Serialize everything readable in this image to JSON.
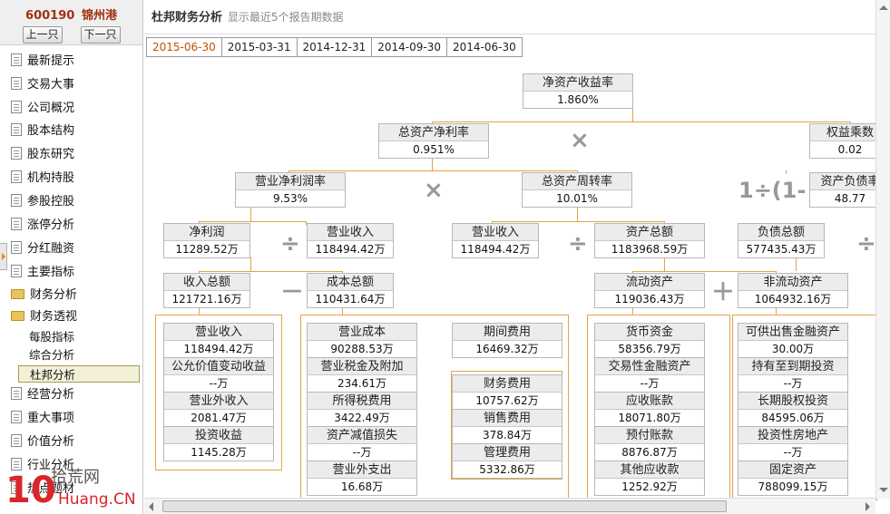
{
  "stock": {
    "code": "600190",
    "name": "锦州港",
    "prev_btn": "上一只",
    "next_btn": "下一只"
  },
  "nav": [
    {
      "label": "最新提示",
      "icon": "doc-icon"
    },
    {
      "label": "交易大事",
      "icon": "doc-icon"
    },
    {
      "label": "公司概况",
      "icon": "doc-icon"
    },
    {
      "label": "股本结构",
      "icon": "doc-icon"
    },
    {
      "label": "股东研究",
      "icon": "doc-icon"
    },
    {
      "label": "机构持股",
      "icon": "doc-icon"
    },
    {
      "label": "参股控股",
      "icon": "doc-icon"
    },
    {
      "label": "涨停分析",
      "icon": "doc-icon"
    },
    {
      "label": "分红融资",
      "icon": "doc-icon"
    },
    {
      "label": "主要指标",
      "icon": "doc-icon"
    },
    {
      "label": "财务分析",
      "icon": "folder-icon"
    },
    {
      "label": "财务透视",
      "icon": "folder-open-icon"
    }
  ],
  "sub_nav": [
    {
      "label": "每股指标"
    },
    {
      "label": "综合分析"
    },
    {
      "label": "杜邦分析"
    }
  ],
  "nav2": [
    {
      "label": "经营分析"
    },
    {
      "label": "重大事项"
    },
    {
      "label": "价值分析"
    },
    {
      "label": "行业分析"
    },
    {
      "label": "热点题材"
    }
  ],
  "logo": {
    "main": "拾荒网",
    "url": "Huang.CN",
    "num": "10"
  },
  "page": {
    "title": "杜邦财务分析",
    "subtitle": "显示最近5个报告期数据"
  },
  "tabs": [
    "2015-06-30",
    "2015-03-31",
    "2014-12-31",
    "2014-09-30",
    "2014-06-30"
  ],
  "active_tab": 0,
  "ops": {
    "times": "×",
    "divide": "÷",
    "minus": "－",
    "plus": "＋",
    "one_minus": "1÷(1-"
  },
  "nodes": {
    "roe": {
      "label": "净资产收益率",
      "value": "1.860%"
    },
    "roa": {
      "label": "总资产净利率",
      "value": "0.951%"
    },
    "em": {
      "label": "权益乘数",
      "value": "0.02"
    },
    "npm": {
      "label": "营业净利润率",
      "value": "9.53%"
    },
    "tat": {
      "label": "总资产周转率",
      "value": "10.01%"
    },
    "dr": {
      "label": "资产负债率",
      "value": "48.77"
    },
    "np": {
      "label": "净利润",
      "value": "11289.52万"
    },
    "rev1": {
      "label": "营业收入",
      "value": "118494.42万"
    },
    "rev2": {
      "label": "营业收入",
      "value": "118494.42万"
    },
    "ta": {
      "label": "资产总额",
      "value": "1183968.59万"
    },
    "tl": {
      "label": "负债总额",
      "value": "577435.43万"
    },
    "ti": {
      "label": "收入总额",
      "value": "121721.16万"
    },
    "tc": {
      "label": "成本总额",
      "value": "110431.64万"
    },
    "ca": {
      "label": "流动资产",
      "value": "119036.43万"
    },
    "nca": {
      "label": "非流动资产",
      "value": "1064932.16万"
    },
    "i_rev": {
      "label": "营业收入",
      "value": "118494.42万"
    },
    "i_fv": {
      "label": "公允价值变动收益",
      "value": "--万"
    },
    "i_noi": {
      "label": "营业外收入",
      "value": "2081.47万"
    },
    "i_inv": {
      "label": "投资收益",
      "value": "1145.28万"
    },
    "c_cost": {
      "label": "营业成本",
      "value": "90288.53万"
    },
    "c_tax": {
      "label": "营业税金及附加",
      "value": "234.61万"
    },
    "c_it": {
      "label": "所得税费用",
      "value": "3422.49万"
    },
    "c_imp": {
      "label": "资产减值损失",
      "value": "--万"
    },
    "c_noe": {
      "label": "营业外支出",
      "value": "16.68万"
    },
    "pe": {
      "label": "期间费用",
      "value": "16469.32万"
    },
    "pe_fin": {
      "label": "财务费用",
      "value": "10757.62万"
    },
    "pe_sell": {
      "label": "销售费用",
      "value": "378.84万"
    },
    "pe_adm": {
      "label": "管理费用",
      "value": "5332.86万"
    },
    "ca_cash": {
      "label": "货币资金",
      "value": "58356.79万"
    },
    "ca_tfa": {
      "label": "交易性金融资产",
      "value": "--万"
    },
    "ca_ar": {
      "label": "应收账款",
      "value": "18071.80万"
    },
    "ca_pp": {
      "label": "预付账款",
      "value": "8876.87万"
    },
    "ca_oth": {
      "label": "其他应收款",
      "value": "1252.92万"
    },
    "nca_afs": {
      "label": "可供出售金融资产",
      "value": "30.00万"
    },
    "nca_htm": {
      "label": "持有至到期投资",
      "value": "--万"
    },
    "nca_lte": {
      "label": "长期股权投资",
      "value": "84595.06万"
    },
    "nca_ire": {
      "label": "投资性房地产",
      "value": "--万"
    },
    "nca_fa": {
      "label": "固定资产",
      "value": "788099.15万"
    }
  }
}
